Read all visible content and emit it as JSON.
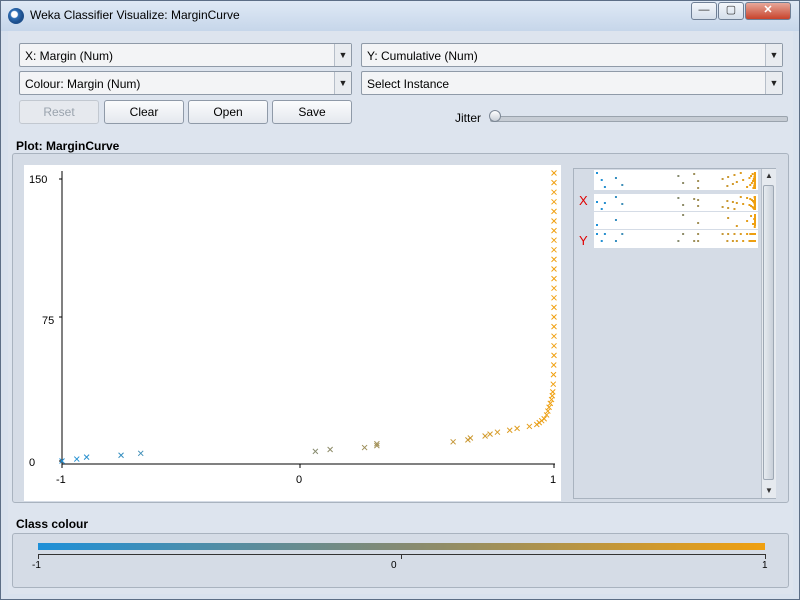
{
  "window": {
    "title": "Weka Classifier Visualize: MarginCurve",
    "min_glyph": "—",
    "max_glyph": "▢",
    "close_glyph": "✕"
  },
  "controls": {
    "x_axis": "X: Margin (Num)",
    "y_axis": "Y: Cumulative (Num)",
    "colour": "Colour: Margin (Num)",
    "instance": "Select Instance",
    "reset": "Reset",
    "clear": "Clear",
    "open": "Open",
    "save": "Save",
    "jitter": "Jitter",
    "jitter_value": 0,
    "dropdown_glyph": "▼"
  },
  "plot": {
    "label": "Plot: MarginCurve",
    "x_ticks": [
      "-1",
      "0",
      "1"
    ],
    "y_ticks": [
      "150",
      "75",
      "0"
    ],
    "strip_x_label": "X",
    "strip_y_label": "Y"
  },
  "class_colour": {
    "label": "Class colour",
    "ticks": [
      "-1",
      "0",
      "1"
    ],
    "colors": [
      "#1e90d8",
      "#848a72",
      "#f0a010"
    ]
  },
  "chart_data": {
    "type": "scatter",
    "title": "MarginCurve",
    "xlabel": "Margin",
    "ylabel": "Cumulative",
    "xlim": [
      -1,
      1
    ],
    "ylim": [
      0,
      150
    ],
    "marker": "x",
    "color_by": "Margin",
    "points": [
      [
        -1.0,
        0
      ],
      [
        -0.94,
        1
      ],
      [
        -0.9,
        2
      ],
      [
        -0.76,
        3
      ],
      [
        -0.68,
        4
      ],
      [
        0.03,
        5
      ],
      [
        0.09,
        6
      ],
      [
        0.23,
        7
      ],
      [
        0.28,
        8
      ],
      [
        0.28,
        9
      ],
      [
        0.59,
        10
      ],
      [
        0.65,
        11
      ],
      [
        0.66,
        12
      ],
      [
        0.72,
        13
      ],
      [
        0.74,
        14
      ],
      [
        0.77,
        15
      ],
      [
        0.82,
        16
      ],
      [
        0.85,
        17
      ],
      [
        0.9,
        18
      ],
      [
        0.93,
        19
      ],
      [
        0.94,
        20
      ],
      [
        0.95,
        21
      ],
      [
        0.96,
        22
      ],
      [
        0.97,
        24
      ],
      [
        0.975,
        26
      ],
      [
        0.98,
        28
      ],
      [
        0.985,
        30
      ],
      [
        0.99,
        32
      ],
      [
        0.993,
        34
      ],
      [
        0.995,
        36
      ],
      [
        0.997,
        40
      ],
      [
        0.998,
        45
      ],
      [
        0.999,
        50
      ],
      [
        1.0,
        55
      ],
      [
        1.0,
        60
      ],
      [
        1.0,
        65
      ],
      [
        1.0,
        70
      ],
      [
        1.0,
        75
      ],
      [
        1.0,
        80
      ],
      [
        1.0,
        85
      ],
      [
        1.0,
        90
      ],
      [
        1.0,
        95
      ],
      [
        1.0,
        100
      ],
      [
        1.0,
        105
      ],
      [
        1.0,
        110
      ],
      [
        1.0,
        115
      ],
      [
        1.0,
        120
      ],
      [
        1.0,
        125
      ],
      [
        1.0,
        130
      ],
      [
        1.0,
        135
      ],
      [
        1.0,
        140
      ],
      [
        1.0,
        145
      ],
      [
        1.0,
        150
      ]
    ]
  }
}
